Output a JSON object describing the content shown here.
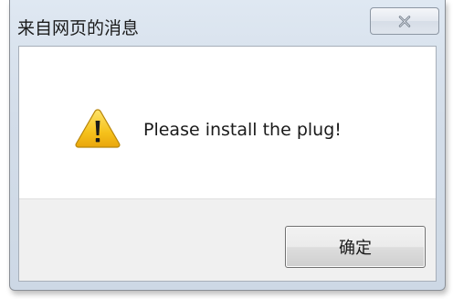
{
  "dialog": {
    "title": "来自网页的消息",
    "message": "Please install the plug!",
    "ok_label": "确定",
    "close_icon": "close-icon",
    "message_icon": "warning-icon"
  },
  "colors": {
    "frame": "#d3dde9",
    "footer": "#f0f0f0",
    "warning_fill": "#f6c21c",
    "warning_mark": "#1a1a1a"
  }
}
